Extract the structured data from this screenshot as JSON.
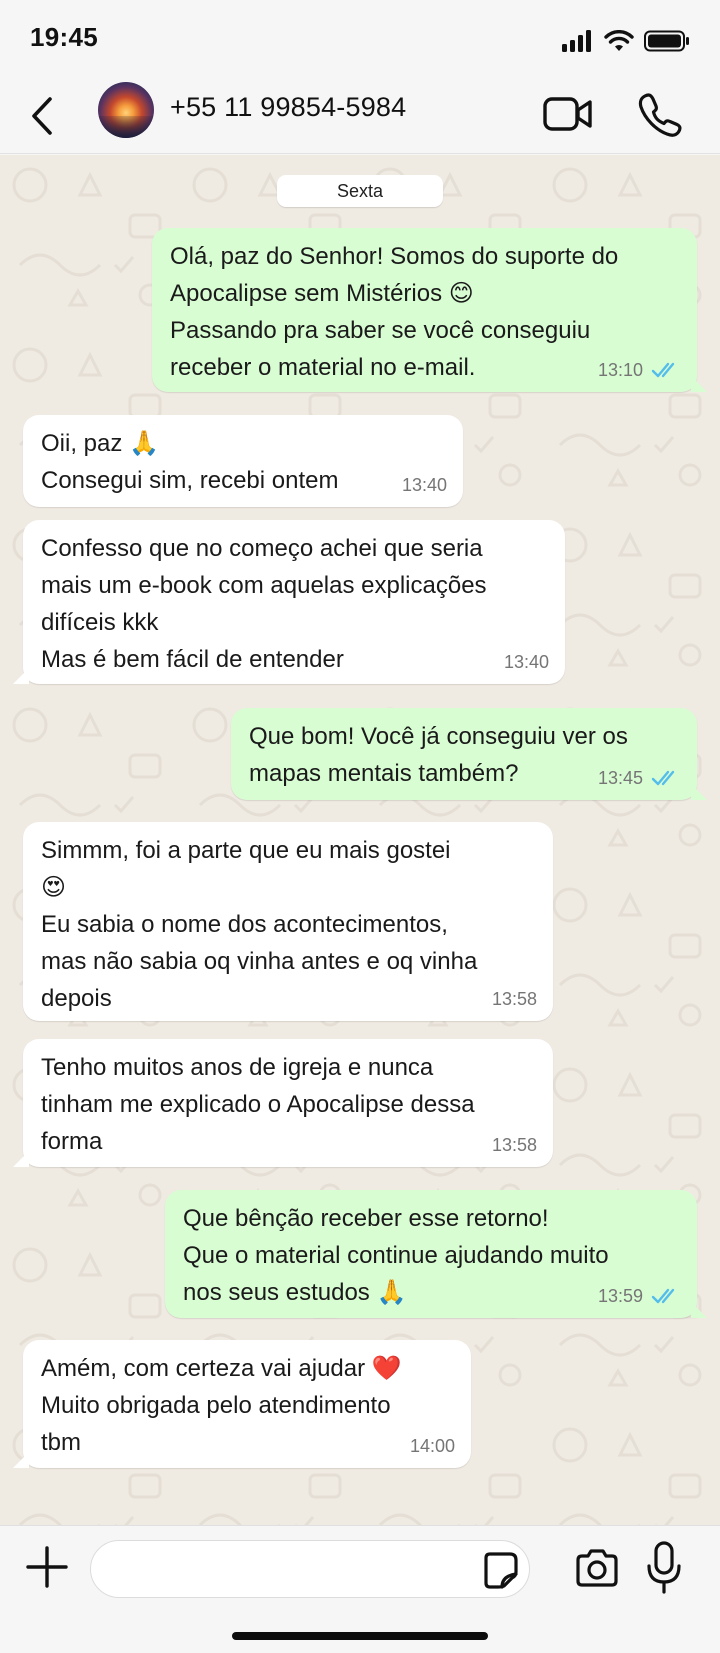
{
  "status_bar": {
    "time": "19:45"
  },
  "header": {
    "contact_name": "+55 11 99854-5984"
  },
  "chat": {
    "date_label": "Sexta",
    "messages": [
      {
        "direction": "out",
        "text": "Olá, paz do Senhor! Somos do suporte do\nApocalipse sem Mistérios 😊\nPassando pra saber se você conseguiu\nreceber o material no e-mail.",
        "time": "13:10",
        "status": "read"
      },
      {
        "direction": "in",
        "text": "Oii, paz 🙏\nConsegui sim, recebi ontem",
        "time": "13:40"
      },
      {
        "direction": "in",
        "text": "Confesso que no começo achei que seria\nmais um e-book com aquelas explicações\ndifíceis kkk\nMas é bem fácil de entender",
        "time": "13:40"
      },
      {
        "direction": "out",
        "text": "Que bom! Você já conseguiu ver os\nmapas mentais também?",
        "time": "13:45",
        "status": "read"
      },
      {
        "direction": "in",
        "text": "Simmm, foi a parte que eu mais gostei\n😍\nEu sabia o nome dos acontecimentos,\nmas não sabia oq vinha antes e oq vinha\ndepois",
        "time": "13:58"
      },
      {
        "direction": "in",
        "text": "Tenho muitos anos de igreja e nunca\ntinham me explicado o Apocalipse dessa\nforma",
        "time": "13:58"
      },
      {
        "direction": "out",
        "text": "Que bênção receber esse retorno!\nQue o material continue ajudando muito\nnos seus estudos 🙏",
        "time": "13:59",
        "status": "read"
      },
      {
        "direction": "in",
        "text": "Amém, com certeza vai ajudar ❤️\nMuito obrigada pelo atendimento\ntbm",
        "time": "14:00"
      }
    ]
  },
  "composer": {
    "placeholder": ""
  },
  "icons": {
    "back": "chevron-left-icon",
    "video": "video-camera-icon",
    "call": "phone-icon",
    "add": "plus-icon",
    "sticker": "sticker-icon",
    "camera": "camera-icon",
    "mic": "microphone-icon",
    "read_receipt": "double-check-icon"
  },
  "colors": {
    "outgoing_bubble": "#d9fdd3",
    "incoming_bubble": "#ffffff",
    "chat_background": "#efeae2",
    "read_tick": "#53bdeb"
  }
}
